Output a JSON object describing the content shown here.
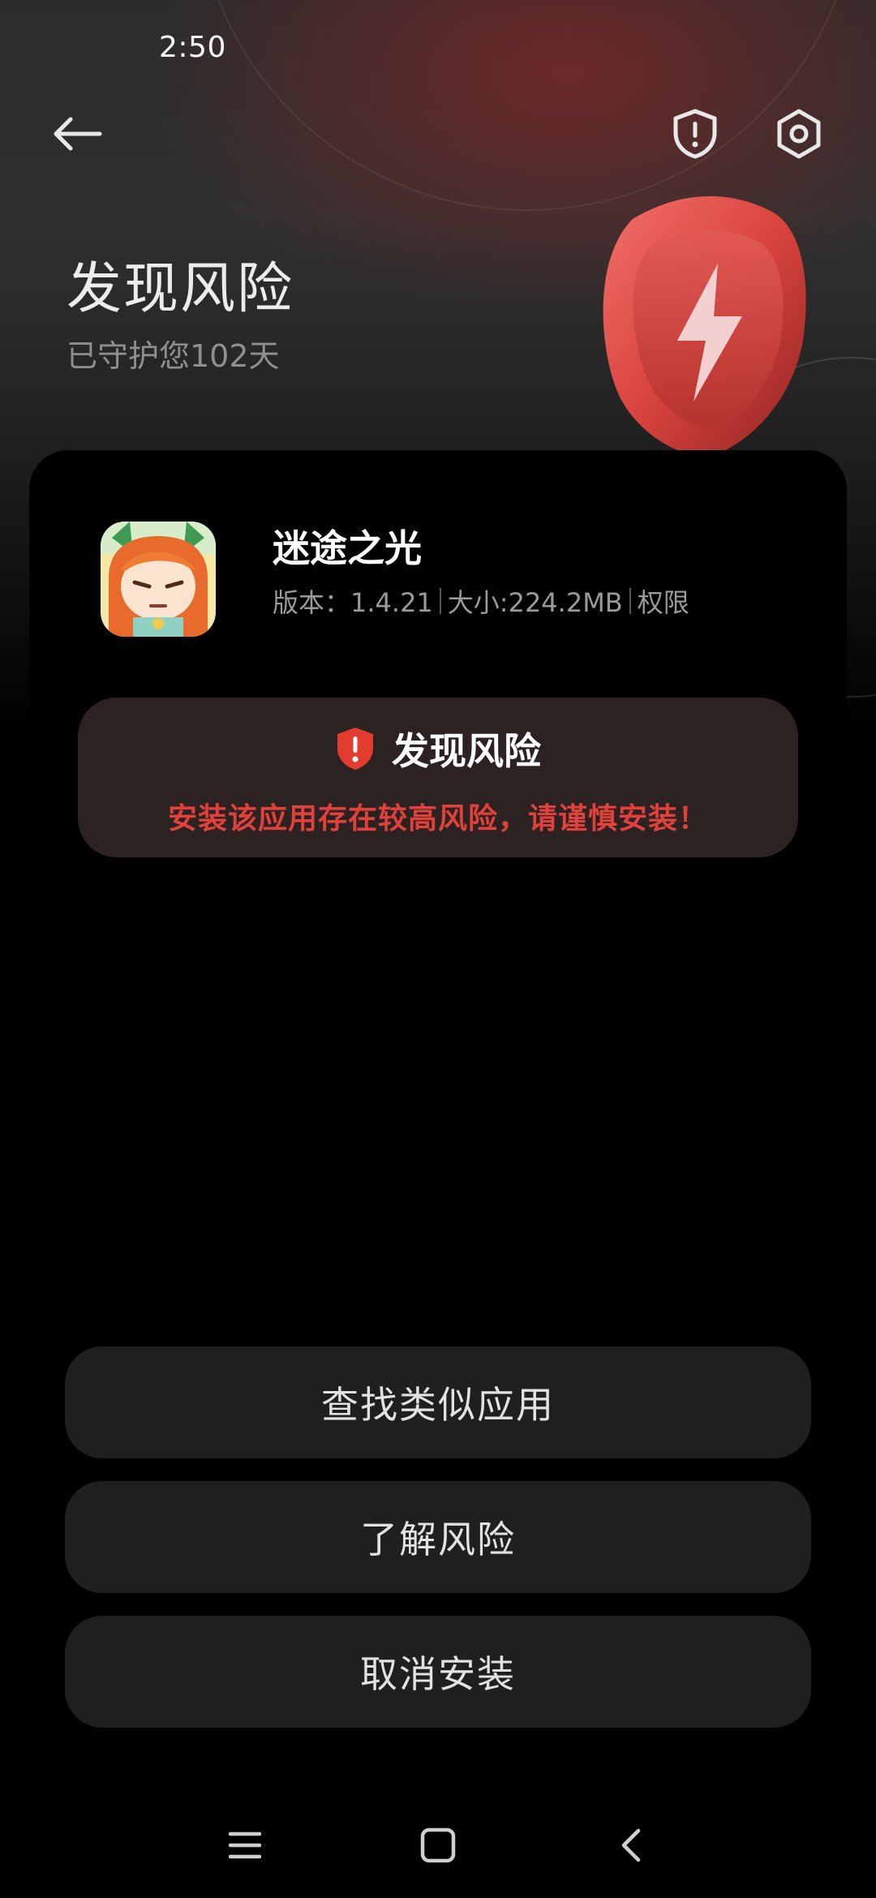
{
  "status_bar": {
    "time": "2:50"
  },
  "header": {
    "title": "发现风险",
    "subtitle": "已守护您102天"
  },
  "icons": {
    "back": "back-arrow-icon",
    "shield": "shield-alert-icon",
    "settings": "gear-icon",
    "hero": "lightning-shield-icon"
  },
  "app": {
    "name": "迷途之光",
    "version_label": "版本：1.4.21",
    "size_label": "大小:224.2MB",
    "permissions_label": "权限"
  },
  "risk": {
    "title": "发现风险",
    "message": "安装该应用存在较高风险，请谨慎安装！"
  },
  "actions": {
    "find_similar": "查找类似应用",
    "learn_risk": "了解风险",
    "cancel_install": "取消安装"
  },
  "colors": {
    "accent_red": "#e0413a",
    "risk_bg": "#2d2222",
    "button_bg": "#1f1f1f"
  }
}
